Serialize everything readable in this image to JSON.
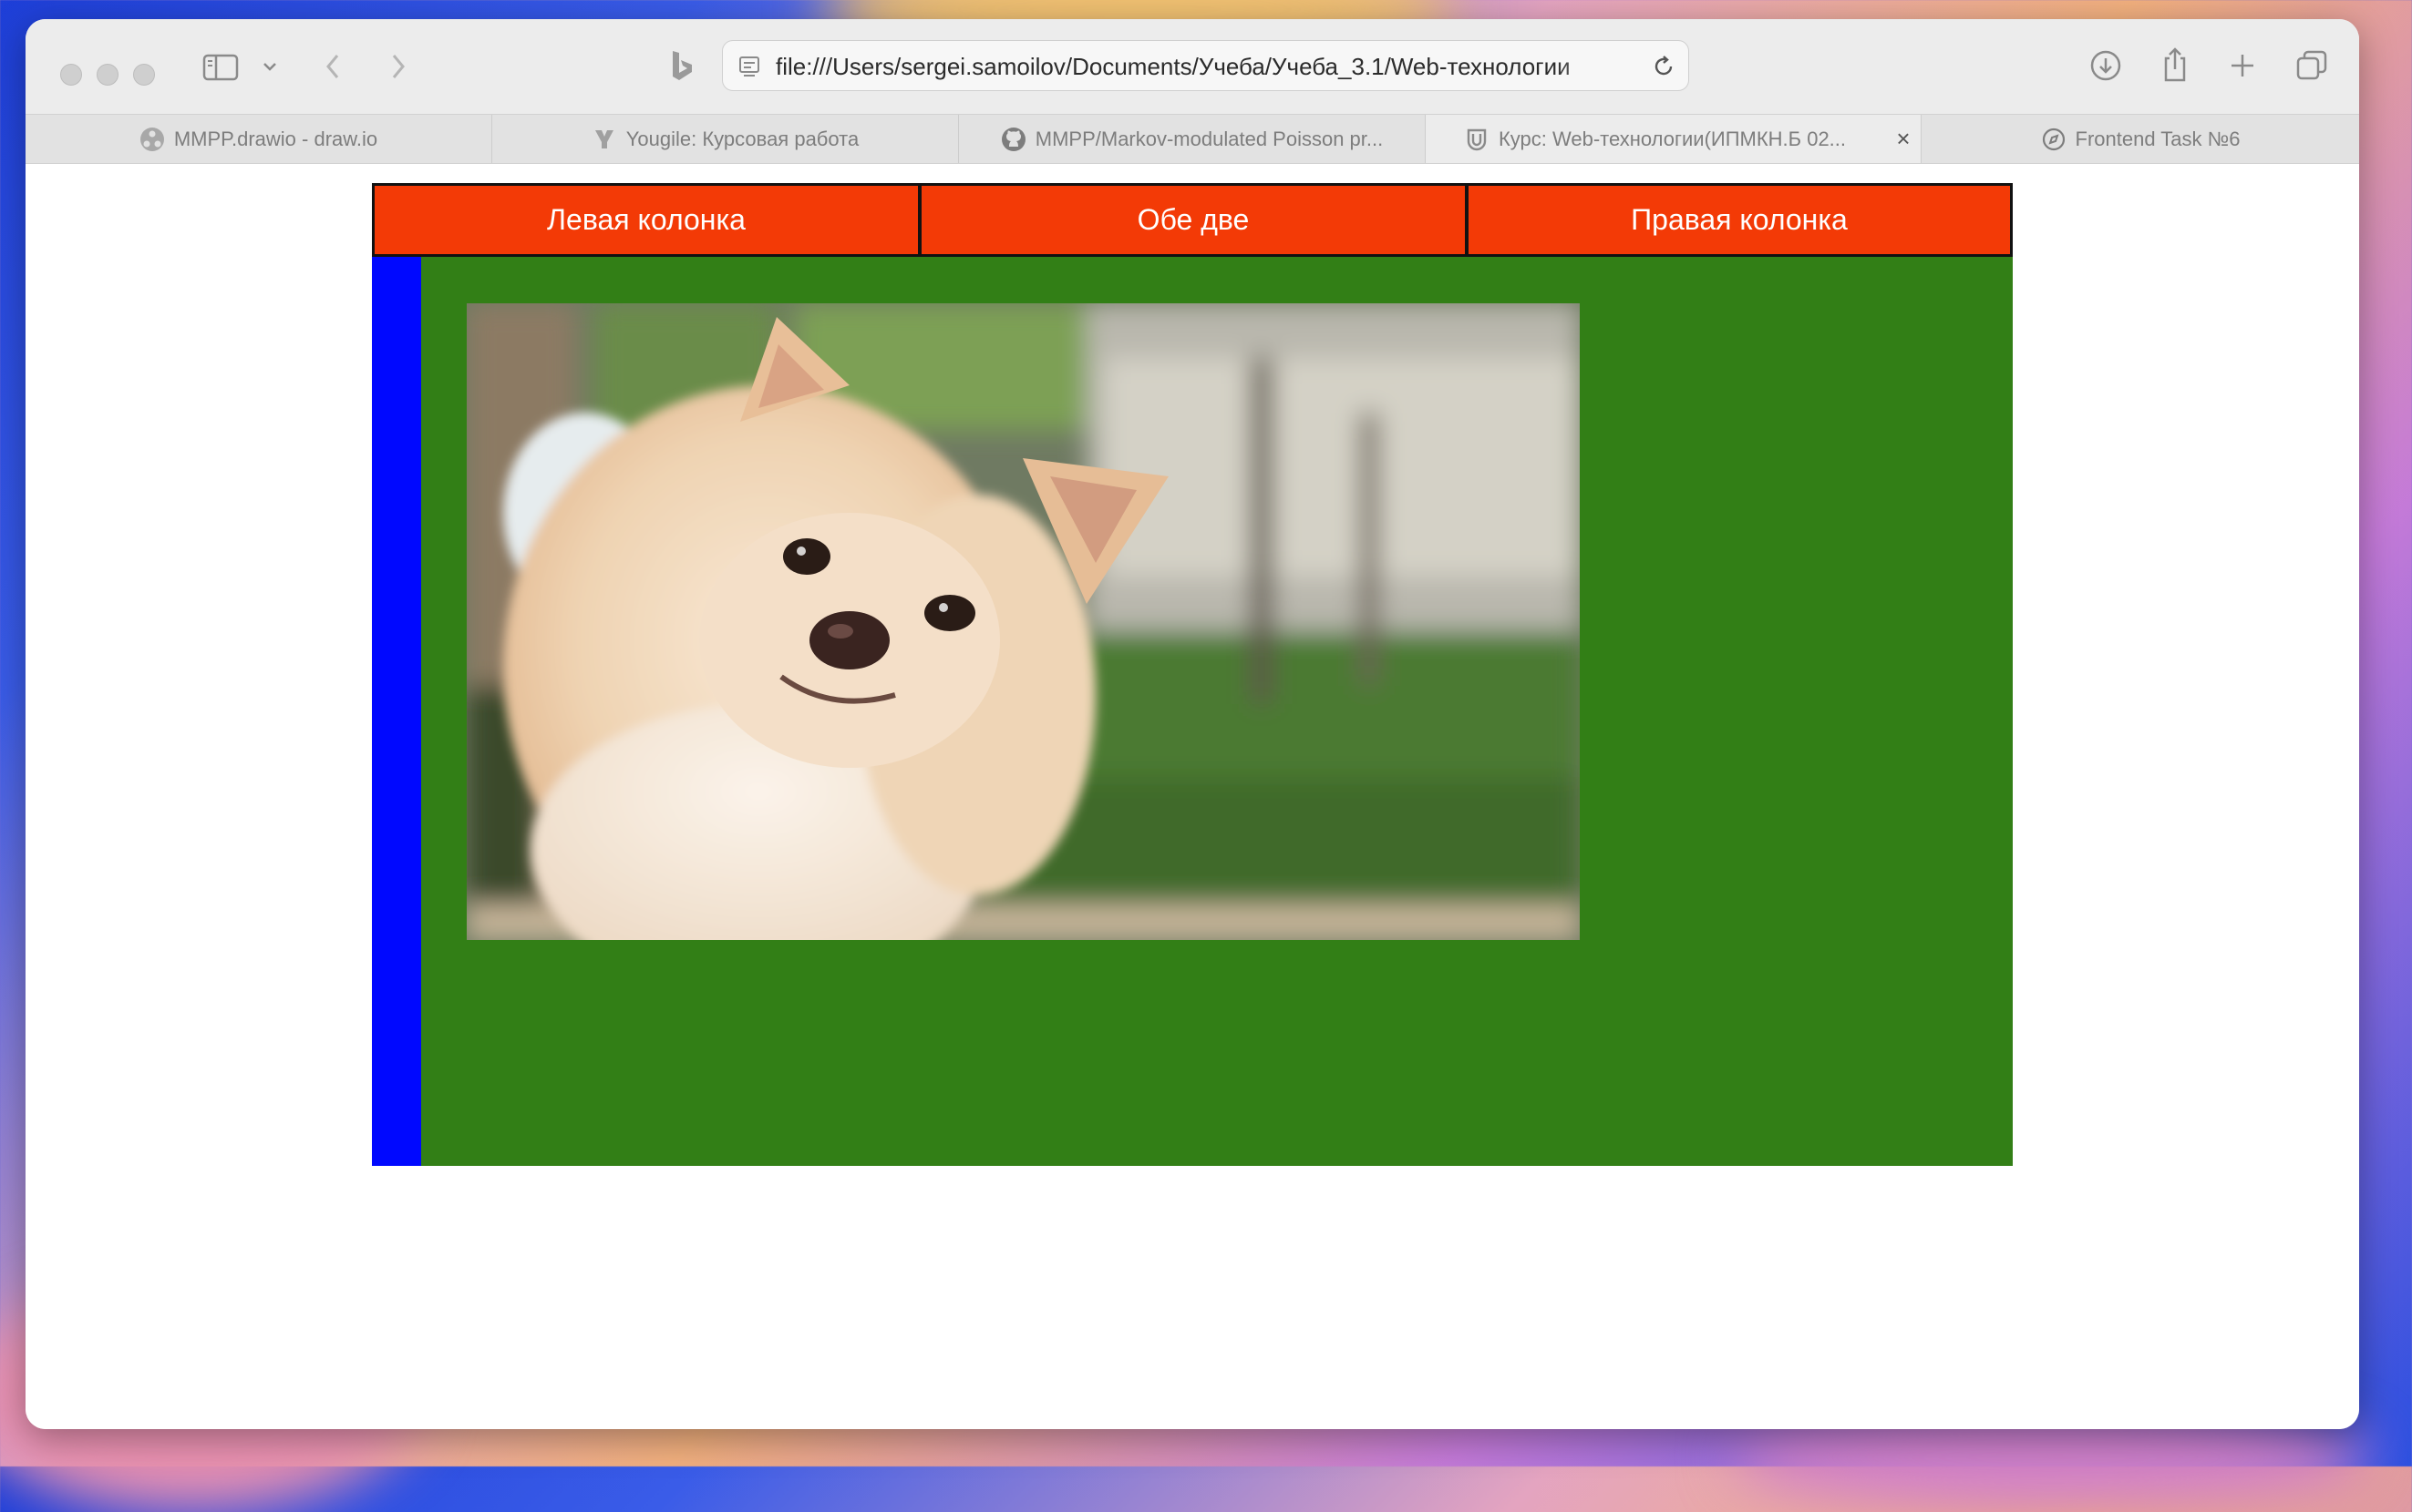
{
  "browser": {
    "url": "file:///Users/sergei.samoilov/Documents/Учеба/Учеба_3.1/Web-технологии",
    "tabs": [
      {
        "label": "MMPP.drawio - draw.io",
        "icon": "drawio-icon"
      },
      {
        "label": "Yougile: Курсовая работа",
        "icon": "yougile-icon"
      },
      {
        "label": "MMPP/Markov-modulated Poisson pr...",
        "icon": "github-icon"
      },
      {
        "label": "Курс: Web-технологии(ИПМКН.Б 02...",
        "icon": "moodle-icon",
        "active": true
      },
      {
        "label": "Frontend Task №6",
        "icon": "compass-icon"
      }
    ]
  },
  "page": {
    "menu": {
      "left_label": "Левая колонка",
      "both_label": "Обе две",
      "right_label": "Правая колонка"
    },
    "colors": {
      "menu_bg": "#f33a06",
      "main_bg": "#327f16",
      "left_column": "#0008ff"
    },
    "image": {
      "subject": "pomeranian-dog-photo"
    }
  }
}
